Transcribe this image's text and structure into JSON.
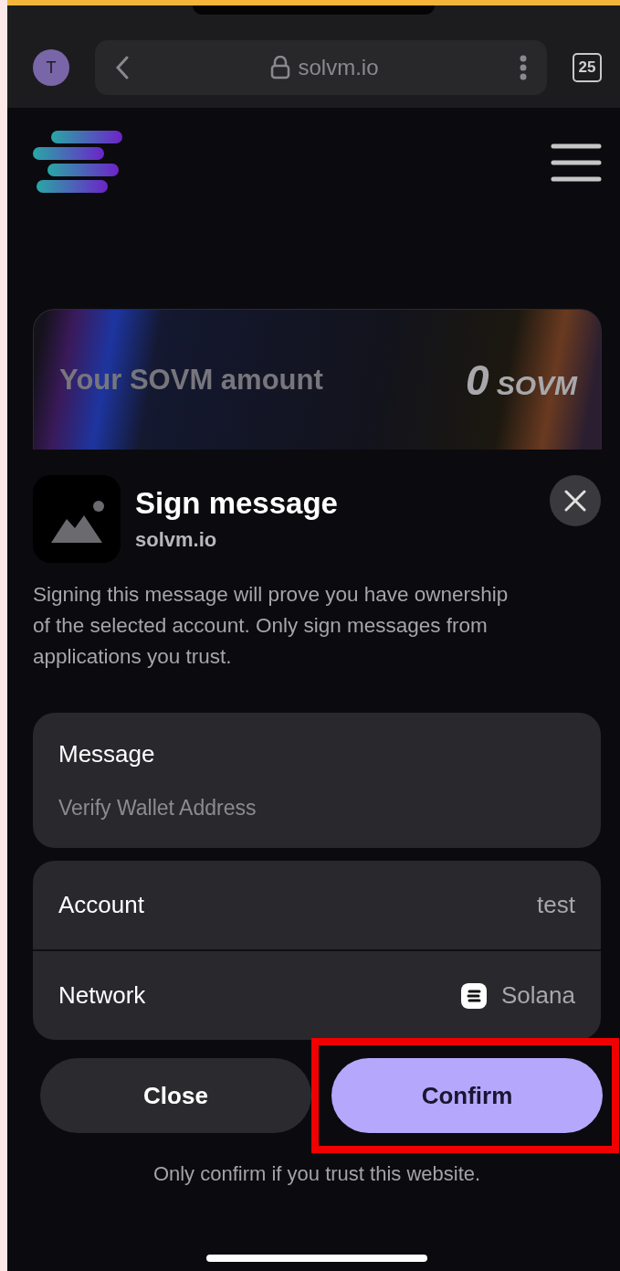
{
  "browser": {
    "avatar": "T",
    "url": "solvm.io",
    "tab_count": "25"
  },
  "balance_card": {
    "label": "Your SOVM amount",
    "amount": "0",
    "unit": "SOVM"
  },
  "sheet": {
    "title": "Sign message",
    "origin": "solvm.io",
    "description": "Signing this message will prove you have ownership of the selected account. Only sign messages from applications you trust.",
    "message": {
      "label": "Message",
      "value": "Verify Wallet Address"
    },
    "details": [
      {
        "label": "Account",
        "value": "test",
        "kind": "text"
      },
      {
        "label": "Network",
        "value": "Solana",
        "kind": "network"
      }
    ],
    "buttons": [
      {
        "label": "Close",
        "kind": "secondary",
        "highlighted": false
      },
      {
        "label": "Confirm",
        "kind": "primary",
        "highlighted": true
      }
    ],
    "note": "Only confirm if you trust this website."
  }
}
